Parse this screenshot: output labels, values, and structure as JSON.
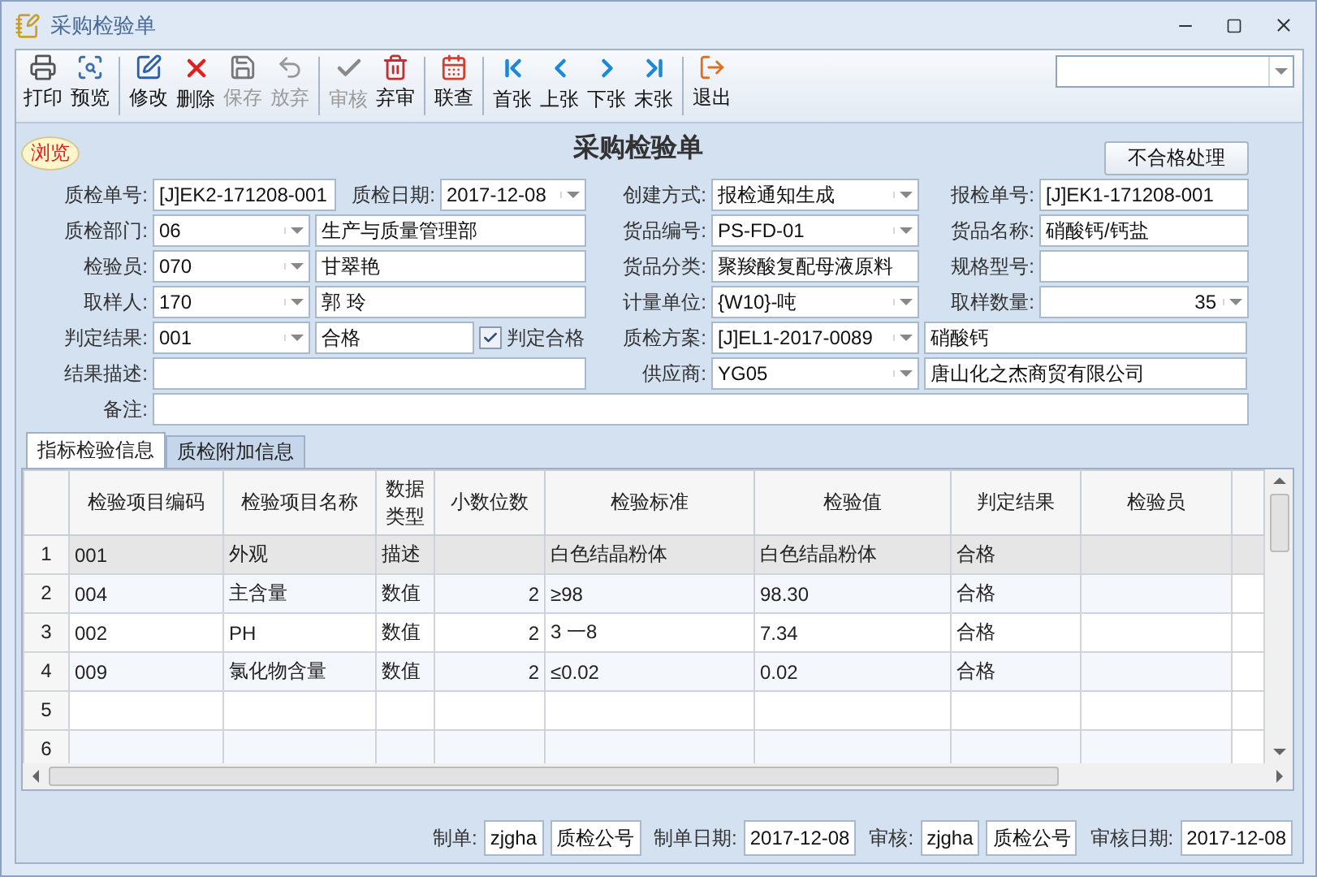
{
  "window": {
    "title": "采购检验单"
  },
  "toolbar": [
    {
      "kind": "button",
      "label": "打印",
      "disabled": false
    },
    {
      "kind": "button",
      "label": "预览",
      "disabled": false
    },
    {
      "kind": "sep"
    },
    {
      "kind": "button",
      "label": "修改",
      "disabled": false
    },
    {
      "kind": "button",
      "label": "删除",
      "disabled": false
    },
    {
      "kind": "button",
      "label": "保存",
      "disabled": true
    },
    {
      "kind": "button",
      "label": "放弃",
      "disabled": true
    },
    {
      "kind": "sep"
    },
    {
      "kind": "button",
      "label": "审核",
      "disabled": true
    },
    {
      "kind": "button",
      "label": "弃审",
      "disabled": false
    },
    {
      "kind": "sep"
    },
    {
      "kind": "button",
      "label": "联查",
      "disabled": false
    },
    {
      "kind": "sep"
    },
    {
      "kind": "button",
      "label": "首张",
      "disabled": false
    },
    {
      "kind": "button",
      "label": "上张",
      "disabled": false
    },
    {
      "kind": "button",
      "label": "下张",
      "disabled": false
    },
    {
      "kind": "button",
      "label": "末张",
      "disabled": false
    },
    {
      "kind": "sep"
    },
    {
      "kind": "button",
      "label": "退出",
      "disabled": false
    }
  ],
  "mode_badge": "浏览",
  "form_title": "采购检验单",
  "reject_button": "不合格处理",
  "form_rows": [
    [
      {
        "kind": "label",
        "text": "质检单号:"
      },
      {
        "kind": "text",
        "value": "[J]EK2-171208-001"
      },
      {
        "kind": "label",
        "text": "质检日期:"
      },
      {
        "kind": "combo",
        "value": "2017-12-08"
      },
      {
        "kind": "label",
        "text": "创建方式:"
      },
      {
        "kind": "combo",
        "value": "报检通知生成"
      },
      {
        "kind": "label",
        "text": "报检单号:"
      },
      {
        "kind": "text",
        "value": "[J]EK1-171208-001"
      }
    ],
    [
      {
        "kind": "label",
        "text": "质检部门:"
      },
      {
        "kind": "combo",
        "value": "06"
      },
      {
        "kind": "text",
        "value": "生产与质量管理部"
      },
      {
        "kind": "label",
        "text": "货品编号:"
      },
      {
        "kind": "combo",
        "value": "PS-FD-01"
      },
      {
        "kind": "label",
        "text": "货品名称:"
      },
      {
        "kind": "text",
        "value": "硝酸钙/钙盐"
      }
    ],
    [
      {
        "kind": "label",
        "text": "检验员:"
      },
      {
        "kind": "combo",
        "value": "070"
      },
      {
        "kind": "text",
        "value": "甘翠艳"
      },
      {
        "kind": "label",
        "text": "货品分类:"
      },
      {
        "kind": "text",
        "value": "聚羧酸复配母液原料"
      },
      {
        "kind": "label",
        "text": "规格型号:"
      },
      {
        "kind": "text"
      }
    ],
    [
      {
        "kind": "label",
        "text": "取样人:"
      },
      {
        "kind": "combo",
        "value": "170"
      },
      {
        "kind": "text",
        "value": "郭  玲"
      },
      {
        "kind": "label",
        "text": "计量单位:"
      },
      {
        "kind": "combo",
        "value": "{W10}-吨"
      },
      {
        "kind": "label",
        "text": "取样数量:"
      },
      {
        "kind": "numcombo",
        "value": "35"
      }
    ],
    [
      {
        "kind": "label",
        "text": "判定结果:"
      },
      {
        "kind": "combo",
        "value": "001"
      },
      {
        "kind": "text",
        "value": "合格"
      },
      {
        "kind": "check",
        "text": "判定合格",
        "checked": true
      },
      {
        "kind": "label",
        "text": "质检方案:"
      },
      {
        "kind": "combo",
        "value": "[J]EL1-2017-0089"
      },
      {
        "kind": "text",
        "value": "硝酸钙"
      }
    ],
    [
      {
        "kind": "label",
        "text": "结果描述:"
      },
      {
        "kind": "text"
      },
      {
        "kind": "label",
        "text": "供应商:"
      },
      {
        "kind": "combo",
        "value": "YG05"
      },
      {
        "kind": "text",
        "value": "唐山化之杰商贸有限公司"
      }
    ],
    [
      {
        "kind": "label",
        "text": "备注:"
      },
      {
        "kind": "text"
      }
    ]
  ],
  "tabs": [
    {
      "label": "指标检验信息",
      "selected": true
    },
    {
      "label": "质检附加信息",
      "selected": false
    }
  ],
  "table": {
    "columns": [
      "检验项目编码",
      "检验项目名称",
      "数据类型",
      "小数位数",
      "检验标准",
      "检验值",
      "判定结果",
      "检验员"
    ],
    "rows": [
      {
        "num": "1",
        "selected": true,
        "cells": [
          "001",
          "外观",
          "描述",
          "",
          "白色结晶粉体",
          "白色结晶粉体",
          "合格",
          ""
        ]
      },
      {
        "num": "2",
        "selected": false,
        "cells": [
          "004",
          "主含量",
          "数值",
          "2",
          "≥98",
          "98.30",
          "合格",
          ""
        ]
      },
      {
        "num": "3",
        "selected": false,
        "cells": [
          "002",
          "PH",
          "数值",
          "2",
          "3 一8",
          "7.34",
          "合格",
          ""
        ]
      },
      {
        "num": "4",
        "selected": false,
        "cells": [
          "009",
          "氯化物含量",
          "数值",
          "2",
          "≤0.02",
          "0.02",
          "合格",
          ""
        ]
      },
      {
        "num": "5",
        "selected": false,
        "cells": [
          "",
          "",
          "",
          "",
          "",
          "",
          "",
          ""
        ]
      },
      {
        "num": "6",
        "selected": false,
        "cells": [
          "",
          "",
          "",
          "",
          "",
          "",
          "",
          ""
        ]
      }
    ]
  },
  "footer": [
    {
      "kind": "label",
      "text": "制单:"
    },
    {
      "kind": "field",
      "value": "zjgha"
    },
    {
      "kind": "field",
      "value": "质检公号"
    },
    {
      "kind": "label",
      "text": "制单日期:"
    },
    {
      "kind": "field",
      "value": "2017-12-08"
    },
    {
      "kind": "label",
      "text": "审核:"
    },
    {
      "kind": "field",
      "value": "zjgha"
    },
    {
      "kind": "field",
      "value": "质检公号"
    },
    {
      "kind": "label",
      "text": "审核日期:"
    },
    {
      "kind": "field",
      "value": "2017-12-08"
    }
  ]
}
